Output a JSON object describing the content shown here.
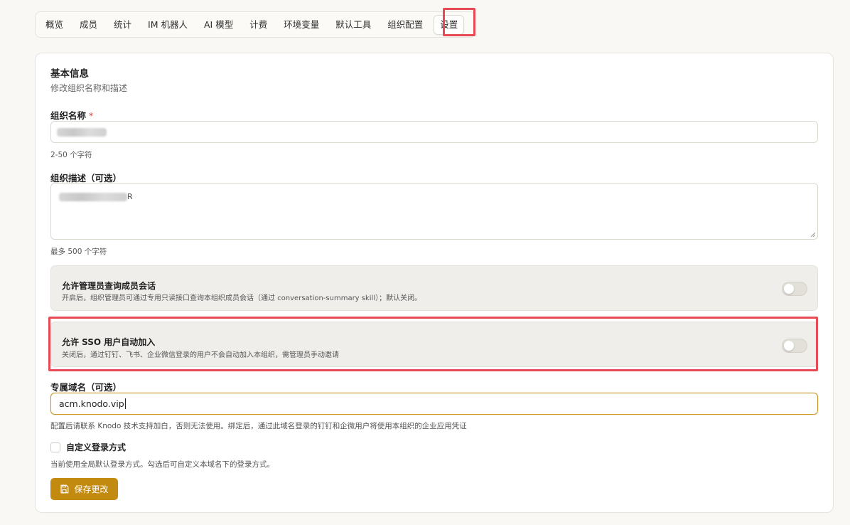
{
  "tabs": [
    {
      "label": "概览"
    },
    {
      "label": "成员"
    },
    {
      "label": "统计"
    },
    {
      "label": "IM 机器人"
    },
    {
      "label": "AI 模型"
    },
    {
      "label": "计费"
    },
    {
      "label": "环境变量"
    },
    {
      "label": "默认工具"
    },
    {
      "label": "组织配置"
    },
    {
      "label": "设置",
      "active": true
    }
  ],
  "section": {
    "title": "基本信息",
    "subtitle": "修改组织名称和描述"
  },
  "org_name": {
    "label": "组织名称",
    "required_mark": "*",
    "hint": "2-50 个字符"
  },
  "org_desc": {
    "label": "组织描述（可选）",
    "visible_char": "R",
    "hint": "最多 500 个字符"
  },
  "toggles": {
    "admin_query": {
      "title": "允许管理员查询成员会话",
      "desc": "开启后，组织管理员可通过专用只读接口查询本组织成员会话（通过 conversation-summary skill）；默认关闭。",
      "enabled": false
    },
    "sso_join": {
      "title": "允许 SSO 用户自动加入",
      "desc": "关闭后，通过钉钉、飞书、企业微信登录的用户不会自动加入本组织，需管理员手动邀请",
      "enabled": false
    }
  },
  "domain": {
    "label": "专属域名（可选）",
    "value": "acm.knodo.vip",
    "hint": "配置后请联系 Knodo 技术支持加白，否则无法使用。绑定后，通过此域名登录的钉钉和企微用户将使用本组织的企业应用凭证"
  },
  "custom_login": {
    "label": "自定义登录方式",
    "checked": false,
    "hint": "当前使用全局默认登录方式。勾选后可自定义本域名下的登录方式。"
  },
  "save_button": {
    "label": "保存更改",
    "icon": "save-icon"
  },
  "colors": {
    "accent": "#c38a10",
    "highlight": "#e74a55",
    "background": "#faf8f4"
  }
}
